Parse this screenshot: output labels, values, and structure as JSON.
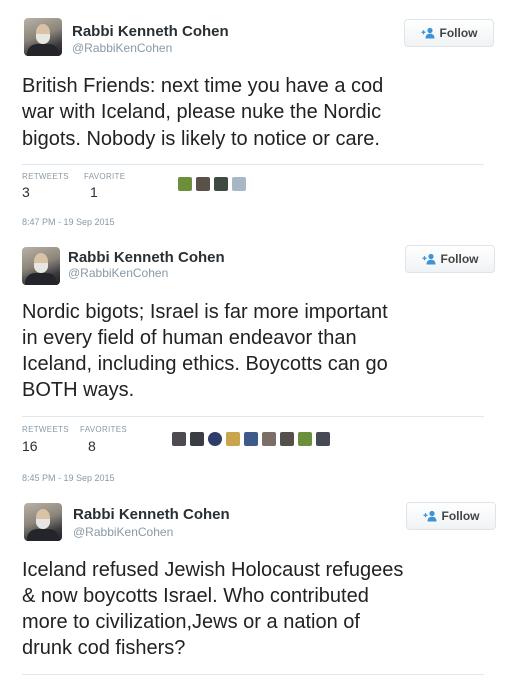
{
  "tweets": [
    {
      "author": {
        "name": "Rabbi Kenneth Cohen",
        "handle": "@RabbiKenCohen"
      },
      "follow_label": "Follow",
      "text_lines": [
        "British Friends: next time you have a cod",
        "war with Iceland, please nuke the Nordic",
        "bigots. Nobody is likely to notice or care."
      ],
      "stats": {
        "retweets_label": "RETWEETS",
        "retweets": "3",
        "favorites_label": "FAVORITE",
        "favorites": "1"
      },
      "liker_colors": [
        "#6b8f3a",
        "#5a5148",
        "#3f4a40",
        "#a9b7c4"
      ],
      "timestamp": "8:47 PM - 19 Sep 2015"
    },
    {
      "author": {
        "name": "Rabbi Kenneth Cohen",
        "handle": "@RabbiKenCohen"
      },
      "follow_label": "Follow",
      "text_lines": [
        "Nordic bigots; Israel is far more important",
        "in every field of human endeavor than",
        "Iceland, including ethics. Boycotts can go",
        "BOTH ways."
      ],
      "stats": {
        "retweets_label": "RETWEETS",
        "retweets": "16",
        "favorites_label": "FAVORITES",
        "favorites": "8"
      },
      "liker_colors": [
        "#4d4a52",
        "#3a3d44",
        "#2f3d6b",
        "#c9a64b",
        "#3d5a8a",
        "#7a6e66",
        "#55504b",
        "#6b8f3a",
        "#474a55"
      ],
      "timestamp": "8:45 PM - 19 Sep 2015"
    },
    {
      "author": {
        "name": "Rabbi Kenneth Cohen",
        "handle": "@RabbiKenCohen"
      },
      "follow_label": "Follow",
      "text_lines": [
        "Iceland refused Jewish Holocaust refugees",
        "& now boycotts Israel. Who contributed",
        "more to civilization,Jews or a nation of",
        "drunk cod fishers?"
      ]
    }
  ],
  "colors": {
    "follow_icon": "#3b94d9",
    "meta_text": "#8899a6"
  }
}
